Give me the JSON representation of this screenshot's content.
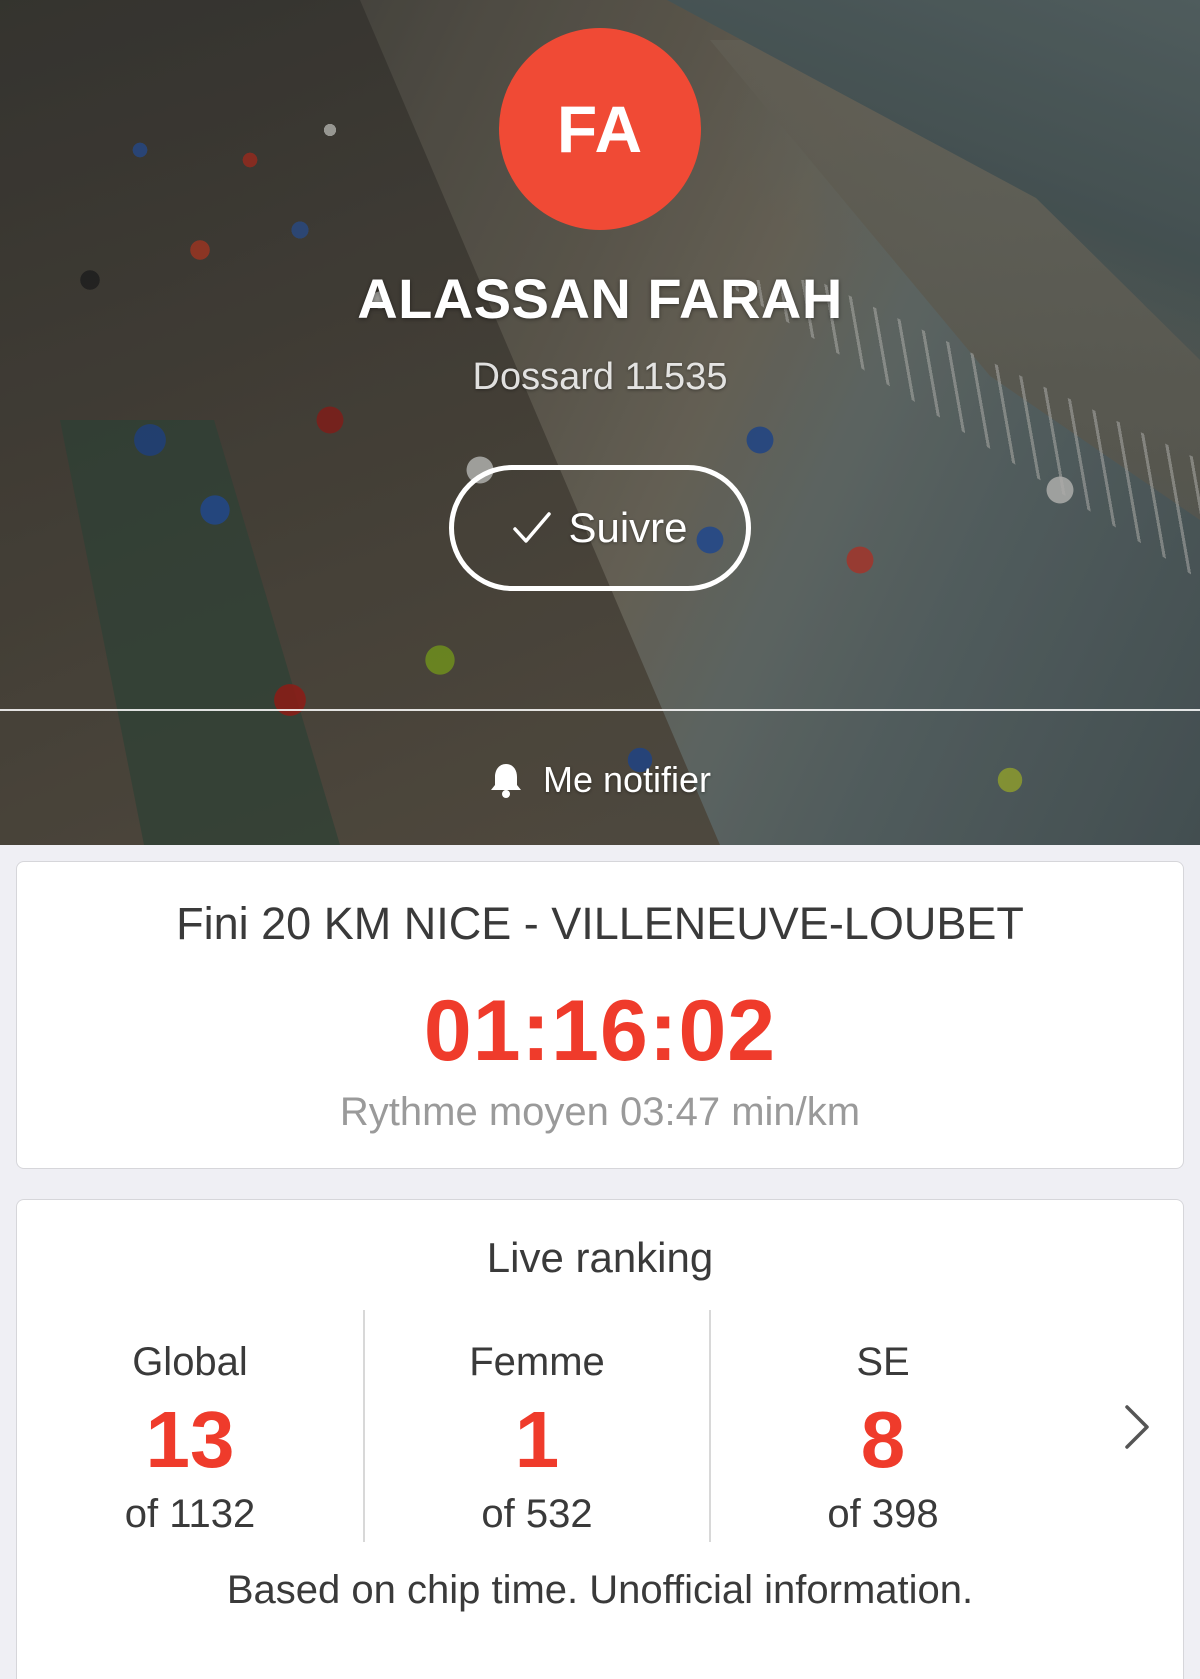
{
  "profile": {
    "initials": "FA",
    "name": "ALASSAN FARAH",
    "bib": "Dossard 11535",
    "follow_label": "Suivre",
    "notify_label": "Me notifier",
    "avatar_color": "#f04a35"
  },
  "result": {
    "race_title": "Fini 20 KM NICE - VILLENEUVE-LOUBET",
    "finish_time": "01:16:02",
    "pace": "Rythme moyen 03:47 min/km",
    "accent_color": "#ef3b2b"
  },
  "ranking": {
    "title": "Live ranking",
    "columns": [
      {
        "label": "Global",
        "rank": "13",
        "total": "of 1132"
      },
      {
        "label": "Femme",
        "rank": "1",
        "total": "of 532"
      },
      {
        "label": "SE",
        "rank": "8",
        "total": "of 398"
      }
    ],
    "disclaimer": "Based on chip time. Unofficial information."
  },
  "icons": {
    "follow": "check-icon",
    "notify": "bell-icon",
    "more": "chevron-right-icon"
  }
}
